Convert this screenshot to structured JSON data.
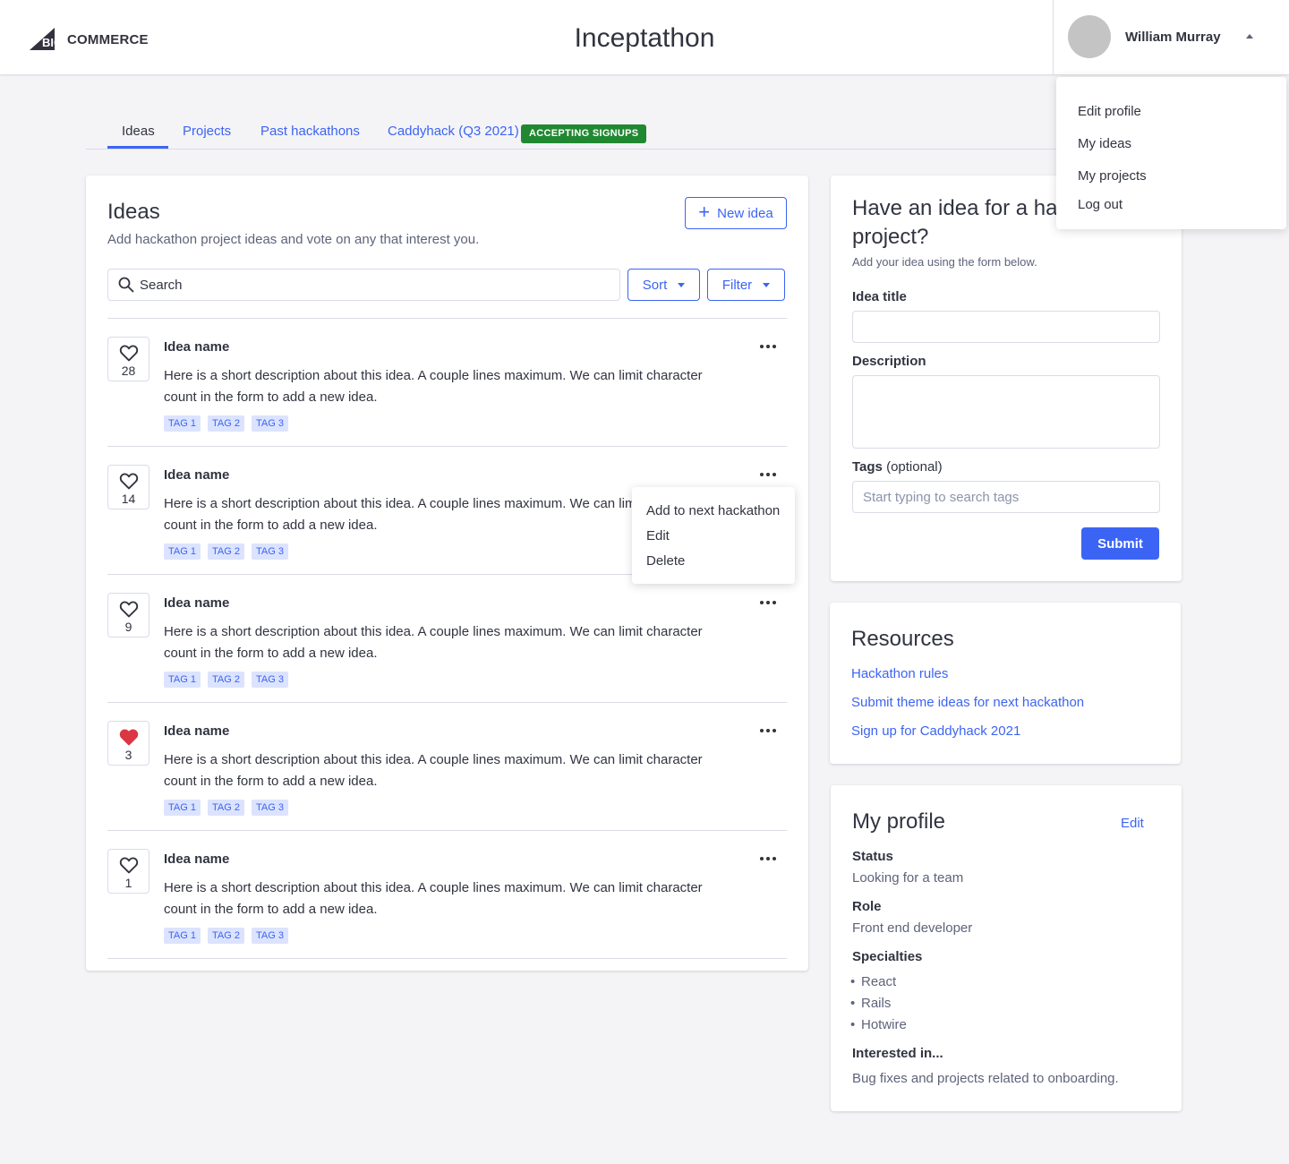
{
  "header": {
    "logo_text": "COMMERCE",
    "logo_mark_text": "BIG",
    "title": "Inceptathon",
    "user_name": "William Murray"
  },
  "user_menu": {
    "items": [
      "Edit profile",
      "My ideas",
      "My projects",
      "Log out"
    ]
  },
  "tabs": [
    {
      "label": "Ideas",
      "active": true
    },
    {
      "label": "Projects",
      "active": false
    },
    {
      "label": "Past hackathons",
      "active": false
    },
    {
      "label": "Caddyhack (Q3 2021)",
      "active": false
    }
  ],
  "tab_badge": "ACCEPTING SIGNUPS",
  "ideas": {
    "title": "Ideas",
    "subtitle": "Add hackathon project ideas and vote on any that interest you.",
    "new_idea_label": "New idea",
    "search_placeholder": "Search",
    "sort_label": "Sort",
    "filter_label": "Filter",
    "items": [
      {
        "votes": "28",
        "liked": false,
        "name": "Idea name",
        "description": "Here is a short description about this idea. A couple lines maximum. We can limit character count in the form to add a new idea.",
        "tags": [
          "TAG 1",
          "TAG 2",
          "TAG 3"
        ]
      },
      {
        "votes": "14",
        "liked": false,
        "name": "Idea name",
        "description": "Here is a short description about this idea. A couple lines maximum. We can limit character count in the form to add a new idea.",
        "tags": [
          "TAG 1",
          "TAG 2",
          "TAG 3"
        ]
      },
      {
        "votes": "9",
        "liked": false,
        "name": "Idea name",
        "description": "Here is a short description about this idea. A couple lines maximum. We can limit character count in the form to add a new idea.",
        "tags": [
          "TAG 1",
          "TAG 2",
          "TAG 3"
        ]
      },
      {
        "votes": "3",
        "liked": true,
        "name": "Idea name",
        "description": "Here is a short description about this idea. A couple lines maximum. We can limit character count in the form to add a new idea.",
        "tags": [
          "TAG 1",
          "TAG 2",
          "TAG 3"
        ]
      },
      {
        "votes": "1",
        "liked": false,
        "name": "Idea name",
        "description": "Here is a short description about this idea. A couple lines maximum. We can limit character count in the form to add a new idea.",
        "tags": [
          "TAG 1",
          "TAG 2",
          "TAG 3"
        ]
      }
    ]
  },
  "item_menu": {
    "items": [
      "Add to next hackathon",
      "Edit",
      "Delete"
    ]
  },
  "form": {
    "title": "Have an idea for a hackathon project?",
    "subtitle": "Add your idea using the form below.",
    "idea_title_label": "Idea title",
    "idea_title_value": "",
    "description_label": "Description",
    "description_value": "",
    "tags_label": "Tags",
    "tags_optional": "(optional)",
    "tags_placeholder": "Start typing to search tags",
    "submit_label": "Submit"
  },
  "resources": {
    "title": "Resources",
    "links": [
      "Hackathon rules",
      "Submit theme ideas for next hackathon",
      "Sign up for Caddyhack 2021"
    ]
  },
  "profile": {
    "title": "My profile",
    "edit_label": "Edit",
    "status_label": "Status",
    "status_value": "Looking for a team",
    "role_label": "Role",
    "role_value": "Front end developer",
    "specialties_label": "Specialties",
    "specialties": [
      "React",
      "Rails",
      "Hotwire"
    ],
    "interested_label": "Interested in...",
    "interested_value": "Bug fixes and projects related to onboarding."
  },
  "colors": {
    "primary": "#3c64f4",
    "success": "#208831",
    "heart_liked": "#db3643",
    "text": "#313440"
  }
}
